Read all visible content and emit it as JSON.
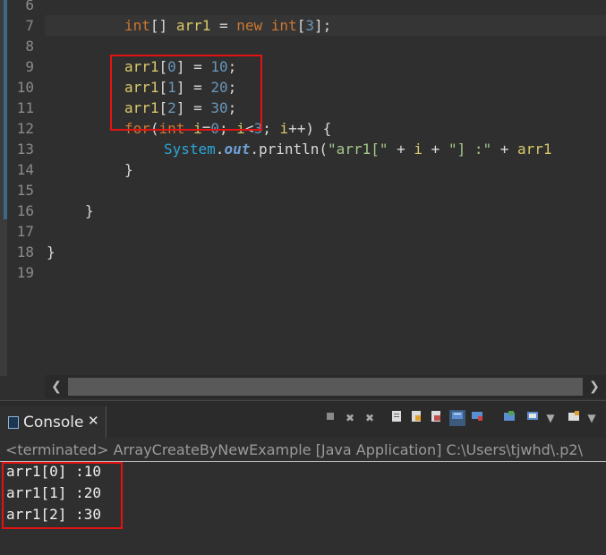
{
  "editor": {
    "line_numbers": [
      "6",
      "7",
      "8",
      "9",
      "10",
      "11",
      "12",
      "13",
      "14",
      "15",
      "16",
      "17",
      "18",
      "19"
    ],
    "line7": {
      "kw_int": "int",
      "brackets": "[] ",
      "var": "arr1",
      "eq": " = ",
      "kw_new": "new",
      "sp": " ",
      "kw_int2": "int",
      "open": "[",
      "num": "3",
      "close": "];"
    },
    "line9": {
      "var": "arr1",
      "open": "[",
      "idx": "0",
      "mid": "] = ",
      "val": "10",
      "end": ";"
    },
    "line10": {
      "var": "arr1",
      "open": "[",
      "idx": "1",
      "mid": "] = ",
      "val": "20",
      "end": ";"
    },
    "line11": {
      "var": "arr1",
      "open": "[",
      "idx": "2",
      "mid": "] = ",
      "val": "30",
      "end": ";"
    },
    "line12": {
      "kw_for": "for",
      "paren": "(",
      "kw_int": "int",
      "sp": " ",
      "var_i": "i",
      "eq": "=",
      "zero": "0",
      "semi": "; ",
      "var_i2": "i",
      "lt": "<",
      "three": "3",
      "semi2": "; ",
      "var_i3": "i",
      "rest": "++) {"
    },
    "line13": {
      "cls": "System",
      "dot": ".",
      "fld": "out",
      "dot2": ".",
      "mth": "println(",
      "str1": "\"arr1[\"",
      "plus1": " + ",
      "var_i": "i",
      "plus2": " + ",
      "str2": "\"] :\"",
      "plus3": " + ",
      "var_arr": "arr1"
    },
    "line14": "}",
    "line16": "}",
    "line18": "}"
  },
  "console": {
    "tab_title": "Console",
    "close_glyph": "✕",
    "status": "<terminated> ArrayCreateByNewExample [Java Application] C:\\Users\\tjwhd\\.p2\\",
    "output": [
      "arr1[0] :10",
      "arr1[1] :20",
      "arr1[2] :30"
    ]
  },
  "colors": {
    "highlight_box": "#e41313",
    "keyword": "#cc7832",
    "variable": "#d9c96a",
    "number": "#6897bb",
    "string": "#a3c98b",
    "class": "#2ba7d9"
  }
}
